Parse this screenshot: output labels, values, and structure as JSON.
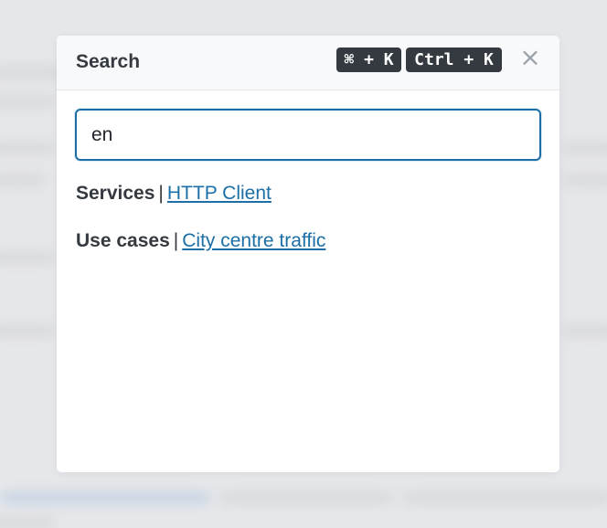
{
  "modal": {
    "title": "Search",
    "shortcut_mac": "⌘ + K",
    "shortcut_win": "Ctrl + K",
    "close_glyph": "×"
  },
  "search": {
    "value": "en",
    "placeholder": ""
  },
  "results": [
    {
      "category": "Services",
      "separator": "|",
      "link": "HTTP Client"
    },
    {
      "category": "Use cases",
      "separator": "|",
      "link": "City centre traffic"
    }
  ],
  "colors": {
    "accent": "#1b6fa6",
    "kbd_bg": "#343a40",
    "overlay": "#e4e5e8"
  },
  "icons": {
    "close": "close-icon"
  }
}
